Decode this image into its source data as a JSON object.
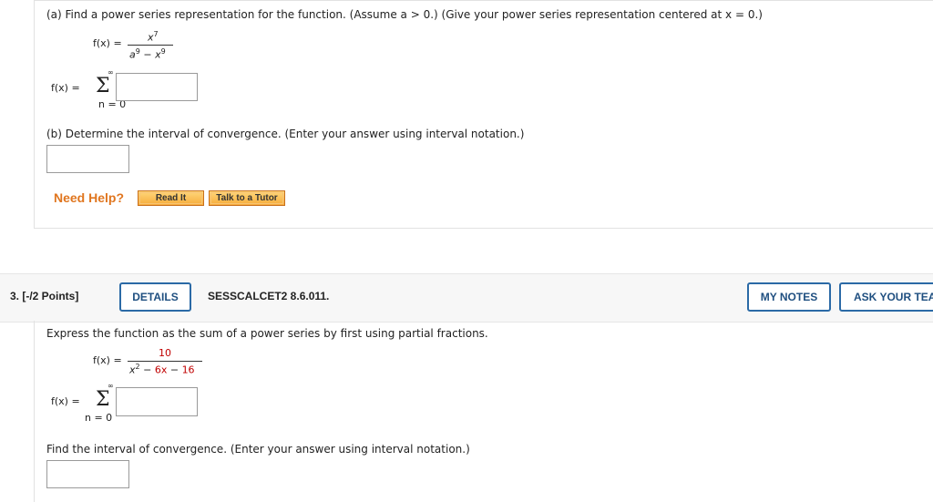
{
  "partA": {
    "prompt": "(a) Find a power series representation for the function. (Assume a > 0.) (Give your power series representation centered at x = 0.)",
    "fx_label": "f(x) =",
    "numerator": "x",
    "numerator_exp": "7",
    "denominator_a": "a",
    "denominator_a_exp": "9",
    "denominator_minus": "−",
    "denominator_x": "x",
    "denominator_x_exp": "9",
    "sum_label": "f(x) =",
    "sum_symbol": "Σ",
    "sum_upper": "∞",
    "sum_lower": "n = 0"
  },
  "partB": {
    "prompt": "(b) Determine the interval of convergence. (Enter your answer using interval notation.)"
  },
  "help": {
    "label": "Need Help?",
    "read_it": "Read It",
    "talk_tutor": "Talk to a Tutor"
  },
  "question3": {
    "number_points": "3. [-/2 Points]",
    "details_button": "DETAILS",
    "code": "SESSCALCET2 8.6.011.",
    "my_notes_button": "MY NOTES",
    "ask_teacher_button": "ASK YOUR TEACHER",
    "prompt": "Express the function as the sum of a power series by first using partial fractions.",
    "fx_label": "f(x) =",
    "numerator": "10",
    "denom_x": "x",
    "denom_x_exp": "2",
    "denom_minus1": "−",
    "denom_6x": "6x",
    "denom_minus2": "−",
    "denom_16": "16",
    "sum_label": "f(x) =",
    "sum_symbol": "Σ",
    "sum_upper": "∞",
    "sum_lower": "n = 0",
    "interval_prompt": "Find the interval of convergence. (Enter your answer using interval notation.)"
  },
  "colors": {
    "accent_blue": "#2b6aa6",
    "need_help_orange": "#e0761f",
    "red_value": "#c00000"
  }
}
